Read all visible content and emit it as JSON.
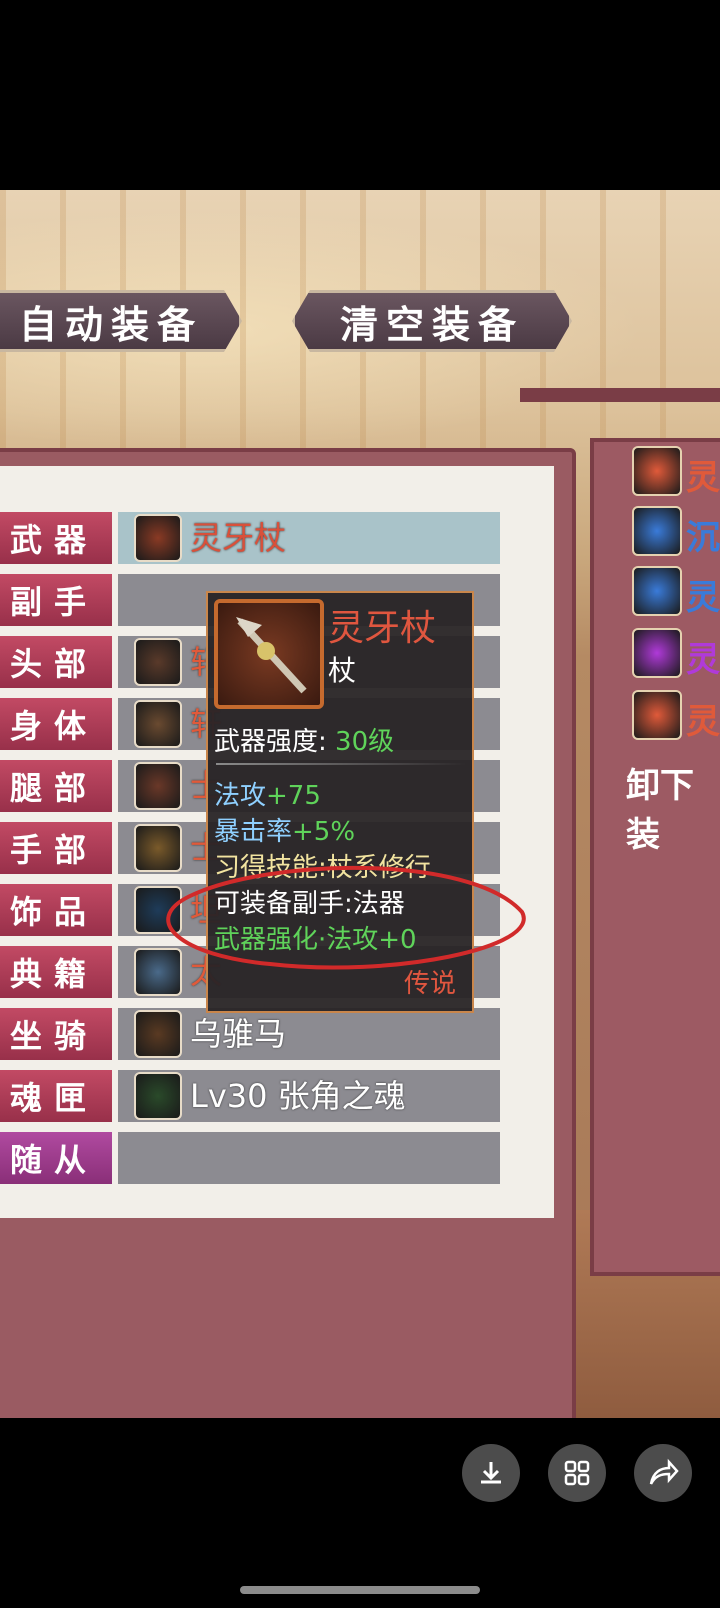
{
  "top_buttons": {
    "auto_equip": "自动装备",
    "clear_equip": "清空装备"
  },
  "equipment_slots": [
    {
      "label": "武器",
      "item": "灵牙杖",
      "item_color": "#d9503a"
    },
    {
      "label": "副手",
      "item": ""
    },
    {
      "label": "头部",
      "item": "轩"
    },
    {
      "label": "身体",
      "item": "轩"
    },
    {
      "label": "腿部",
      "item": "士"
    },
    {
      "label": "手部",
      "item": "士"
    },
    {
      "label": "饰品",
      "item": "坦"
    },
    {
      "label": "典籍",
      "item": "太"
    },
    {
      "label": "坐骑",
      "item": "乌骓马"
    },
    {
      "label": "魂匣",
      "item": "Lv30 张角之魂"
    },
    {
      "label": "随从",
      "item": ""
    }
  ],
  "tooltip": {
    "name": "灵牙杖",
    "type": "杖",
    "strength_label": "武器强度:",
    "strength_value": "30级",
    "stats": [
      {
        "label": "法攻",
        "value": "+75"
      },
      {
        "label": "暴击率",
        "value": "+5%"
      }
    ],
    "skill": "习得技能:杖系修行",
    "offhand": "可装备副手:法器",
    "enhance": "武器强化·法攻+0",
    "rarity": "传说"
  },
  "right_list": [
    {
      "text": "灵",
      "color": "#e05a3a"
    },
    {
      "text": "沉",
      "color": "#3a7bd9"
    },
    {
      "text": "灵",
      "color": "#3a7bd9"
    },
    {
      "text": "灵",
      "color": "#b03ad9"
    },
    {
      "text": "灵",
      "color": "#e05a3a"
    }
  ],
  "right_action": "卸下装",
  "bottom_controls": {
    "download": "download-icon",
    "grid": "grid-icon",
    "share": "share-icon"
  }
}
